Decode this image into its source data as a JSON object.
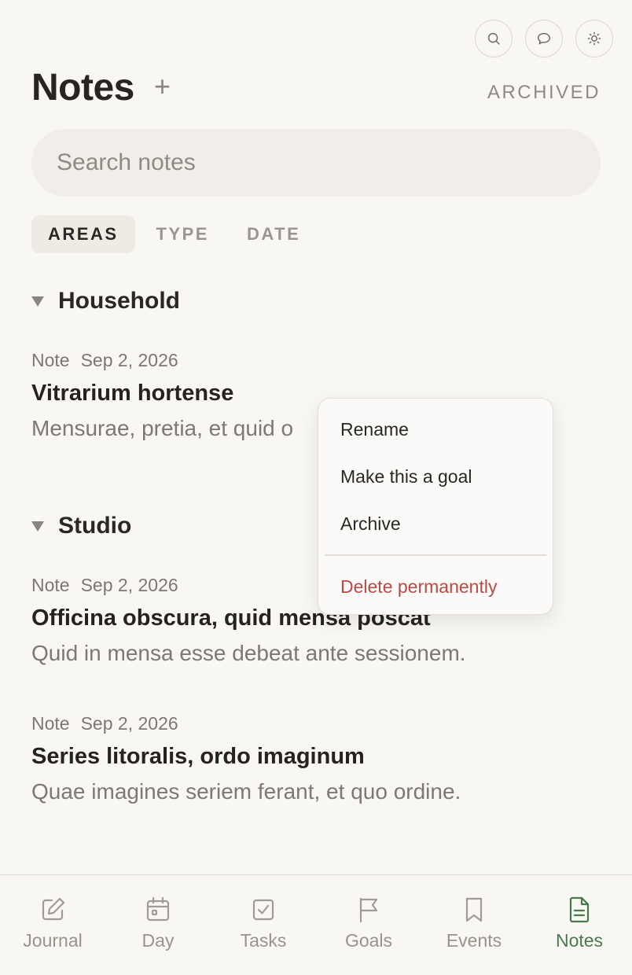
{
  "colors": {
    "accent": "#4a7a4c",
    "danger": "#b84a45",
    "background": "#f9f7f3"
  },
  "top_icons": [
    "search-icon",
    "chat-bubble-icon",
    "sun-icon"
  ],
  "header": {
    "title": "Notes",
    "add_label": "+",
    "archived_label": "ARCHIVED"
  },
  "search": {
    "placeholder": "Search notes",
    "value": ""
  },
  "filters": {
    "areas": "AREAS",
    "type": "TYPE",
    "date": "DATE",
    "selected": "AREAS"
  },
  "sections": [
    {
      "title": "Household",
      "notes": [
        {
          "type": "Note",
          "date": "Sep 2, 2026",
          "title": "Vitrarium hortense",
          "body": "Mensurae, pretia, et quid o"
        }
      ]
    },
    {
      "title": "Studio",
      "notes": [
        {
          "type": "Note",
          "date": "Sep 2, 2026",
          "title": "Officina obscura, quid mensa poscat",
          "body": "Quid in mensa esse debeat ante sessionem."
        },
        {
          "type": "Note",
          "date": "Sep 2, 2026",
          "title": "Series litoralis, ordo imaginum",
          "body": "Quae imagines seriem ferant, et quo ordine."
        }
      ]
    }
  ],
  "context_menu": {
    "rename": "Rename",
    "make_goal": "Make this a goal",
    "archive": "Archive",
    "delete": "Delete permanently"
  },
  "nav": [
    {
      "label": "Journal",
      "icon": "pencil-square-icon"
    },
    {
      "label": "Day",
      "icon": "calendar-icon"
    },
    {
      "label": "Tasks",
      "icon": "checkbox-icon"
    },
    {
      "label": "Goals",
      "icon": "flag-icon"
    },
    {
      "label": "Events",
      "icon": "bookmark-icon"
    },
    {
      "label": "Notes",
      "icon": "document-icon",
      "active": true
    }
  ]
}
